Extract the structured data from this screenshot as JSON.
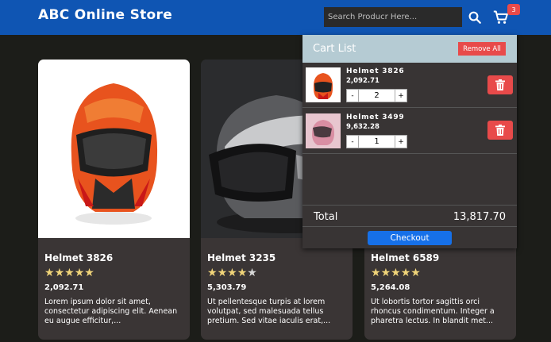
{
  "header": {
    "brand": "ABC Online Store",
    "search_placeholder": "Search Producr Here...",
    "search_icon": "search-icon",
    "cart_icon": "cart-icon",
    "cart_count": "3",
    "bg_color": "#0f55b3"
  },
  "products": [
    {
      "name": "Helmet 3826",
      "rating": 5,
      "price": "2,092.71",
      "description": "Lorem ipsum dolor sit amet, consectetur adipiscing elit. Aenean eu augue efficitur,..."
    },
    {
      "name": "Helmet 3235",
      "rating": 4,
      "price": "5,303.79",
      "description": "Ut pellentesque turpis at lorem volutpat, sed malesuada tellus pretium. Sed vitae iaculis erat,..."
    },
    {
      "name": "Helmet 6589",
      "rating": 5,
      "price": "5,264.08",
      "description": "Ut lobortis tortor sagittis orci rhoncus condimentum. Integer a pharetra lectus. In blandit met..."
    }
  ],
  "cart": {
    "title": "Cart List",
    "remove_all_label": "Remove All",
    "items": [
      {
        "name": "Helmet 3826",
        "price": "2,092.71",
        "qty": "2",
        "minus": "-",
        "plus": "+"
      },
      {
        "name": "Helmet 3499",
        "price": "9,632.28",
        "qty": "1",
        "minus": "-",
        "plus": "+"
      }
    ],
    "total_label": "Total",
    "total_value": "13,817.70",
    "checkout_label": "Checkout"
  },
  "colors": {
    "accent": "#1670e8",
    "danger": "#e84a4a",
    "star": "#f0d479"
  }
}
